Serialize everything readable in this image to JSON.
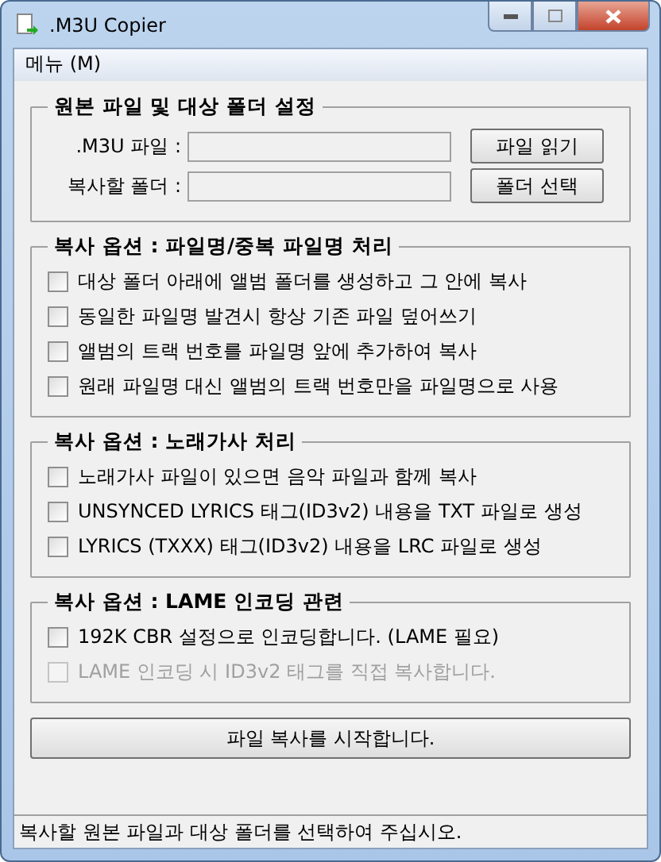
{
  "window": {
    "title": ".M3U Copier"
  },
  "menu": [
    {
      "label": "메뉴 (M)"
    }
  ],
  "source_group": {
    "title": "원본 파일 및 대상 폴더 설정",
    "fields": [
      {
        "label": ".M3U 파일 :",
        "button": "파일 읽기"
      },
      {
        "label": "복사할 폴더 :",
        "button": "폴더 선택"
      }
    ]
  },
  "option_groups": [
    {
      "title": "복사 옵션 : 파일명/중복 파일명 처리",
      "options": [
        {
          "label": "대상 폴더 아래에 앨범 폴더를 생성하고 그 안에 복사",
          "checked": false,
          "disabled": false
        },
        {
          "label": "동일한 파일명 발견시 항상 기존 파일 덮어쓰기",
          "checked": false,
          "disabled": false
        },
        {
          "label": "앨범의 트랙 번호를 파일명 앞에 추가하여 복사",
          "checked": false,
          "disabled": false
        },
        {
          "label": "원래 파일명 대신 앨범의 트랙 번호만을 파일명으로 사용",
          "checked": false,
          "disabled": false
        }
      ]
    },
    {
      "title": "복사 옵션 : 노래가사 처리",
      "options": [
        {
          "label": "노래가사 파일이 있으면 음악 파일과 함께 복사",
          "checked": false,
          "disabled": false
        },
        {
          "label": "UNSYNCED LYRICS 태그(ID3v2) 내용을 TXT 파일로 생성",
          "checked": false,
          "disabled": false
        },
        {
          "label": "LYRICS (TXXX) 태그(ID3v2) 내용을 LRC 파일로 생성",
          "checked": false,
          "disabled": false
        }
      ]
    },
    {
      "title": "복사 옵션 : LAME 인코딩 관련",
      "options": [
        {
          "label": "192K CBR 설정으로 인코딩합니다. (LAME 필요)",
          "checked": false,
          "disabled": false
        },
        {
          "label": "LAME 인코딩 시 ID3v2 태그를 직접 복사합니다.",
          "checked": false,
          "disabled": true
        }
      ]
    }
  ],
  "start_button": "파일 복사를 시작합니다.",
  "status_bar": "복사할 원본 파일과 대상 폴더를 선택하여 주십시오."
}
